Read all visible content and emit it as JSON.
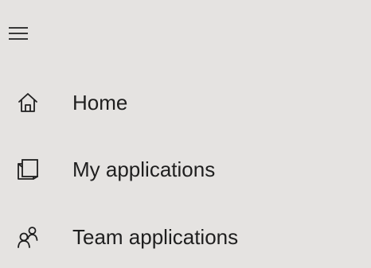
{
  "navigation": {
    "menu_icon": "hamburger-menu-icon",
    "items": [
      {
        "label": "Home",
        "icon": "home-icon"
      },
      {
        "label": "My applications",
        "icon": "my-applications-icon"
      },
      {
        "label": "Team applications",
        "icon": "team-icon"
      }
    ]
  },
  "colors": {
    "background": "#e5e3e1",
    "text": "#1f1f1f"
  }
}
